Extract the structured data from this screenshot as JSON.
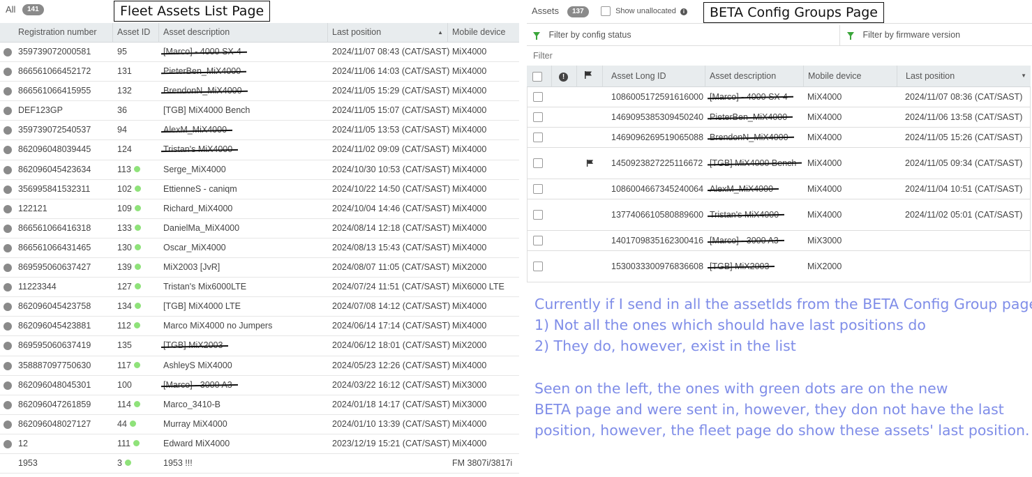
{
  "left": {
    "all_label": "All",
    "count": "141",
    "annotation": "Fleet Assets List Page",
    "headers": [
      "Registration number",
      "Asset ID",
      "Asset description",
      "Last position",
      "Mobile device"
    ],
    "rows": [
      {
        "reg": "359739072000581",
        "id": "95",
        "desc": "[Marco] - 4000 SX-4",
        "struck": true,
        "green": false,
        "pos": "2024/11/07 08:43 (CAT/SAST)",
        "device": "MiX4000",
        "grey": true
      },
      {
        "reg": "866561066452172",
        "id": "131",
        "desc": "PieterBen_MiX4000",
        "struck": true,
        "green": false,
        "pos": "2024/11/06 14:03 (CAT/SAST)",
        "device": "MiX4000",
        "grey": true
      },
      {
        "reg": "866561066415955",
        "id": "132",
        "desc": "BrendonN_MiX4000",
        "struck": true,
        "green": false,
        "pos": "2024/11/05 15:29 (CAT/SAST)",
        "device": "MiX4000",
        "grey": true
      },
      {
        "reg": "DEF123GP",
        "id": "36",
        "desc": "[TGB] MiX4000 Bench",
        "struck": false,
        "green": false,
        "pos": "2024/11/05 15:07 (CAT/SAST)",
        "device": "MiX4000",
        "grey": true
      },
      {
        "reg": "359739072540537",
        "id": "94",
        "desc": "AlexM_MiX4000",
        "struck": true,
        "green": false,
        "pos": "2024/11/05 13:53 (CAT/SAST)",
        "device": "MiX4000",
        "grey": true
      },
      {
        "reg": "862096048039445",
        "id": "124",
        "desc": "Tristan's MiX4000",
        "struck": true,
        "green": false,
        "pos": "2024/11/02 09:09 (CAT/SAST)",
        "device": "MiX4000",
        "grey": true
      },
      {
        "reg": "862096045423634",
        "id": "113",
        "desc": "Serge_MiX4000",
        "struck": false,
        "green": true,
        "pos": "2024/10/30 10:53 (CAT/SAST)",
        "device": "MiX4000",
        "grey": true
      },
      {
        "reg": "356995841532311",
        "id": "102",
        "desc": "EttienneS - caniqm",
        "struck": false,
        "green": true,
        "pos": "2024/10/22 14:50 (CAT/SAST)",
        "device": "MiX4000",
        "grey": true
      },
      {
        "reg": "122121",
        "id": "109",
        "desc": "Richard_MiX4000",
        "struck": false,
        "green": true,
        "pos": "2024/10/04 14:46 (CAT/SAST)",
        "device": "MiX4000",
        "grey": true
      },
      {
        "reg": "866561066416318",
        "id": "133",
        "desc": "DanielMa_MiX4000",
        "struck": false,
        "green": true,
        "pos": "2024/08/14 12:18 (CAT/SAST)",
        "device": "MiX4000",
        "grey": true
      },
      {
        "reg": "866561066431465",
        "id": "130",
        "desc": "Oscar_MiX4000",
        "struck": false,
        "green": true,
        "pos": "2024/08/13 15:43 (CAT/SAST)",
        "device": "MiX4000",
        "grey": true
      },
      {
        "reg": "869595060637427",
        "id": "139",
        "desc": "MiX2003 [JvR]",
        "struck": false,
        "green": true,
        "pos": "2024/08/07 11:05 (CAT/SAST)",
        "device": "MiX2000",
        "grey": true
      },
      {
        "reg": "11223344",
        "id": "127",
        "desc": "Tristan's Mix6000LTE",
        "struck": false,
        "green": true,
        "pos": "2024/07/24 11:51 (CAT/SAST)",
        "device": "MiX6000 LTE",
        "grey": true
      },
      {
        "reg": "862096045423758",
        "id": "134",
        "desc": "[TGB] MiX4000 LTE",
        "struck": false,
        "green": true,
        "pos": "2024/07/08 14:12 (CAT/SAST)",
        "device": "MiX4000",
        "grey": true
      },
      {
        "reg": "862096045423881",
        "id": "112",
        "desc": "Marco MiX4000 no Jumpers",
        "struck": false,
        "green": true,
        "pos": "2024/06/14 17:14 (CAT/SAST)",
        "device": "MiX4000",
        "grey": true
      },
      {
        "reg": "869595060637419",
        "id": "135",
        "desc": "[TGB] MiX2003",
        "struck": true,
        "green": false,
        "pos": "2024/06/12 18:01 (CAT/SAST)",
        "device": "MiX2000",
        "grey": true
      },
      {
        "reg": "358887097750630",
        "id": "117",
        "desc": "AshleyS MiX4000",
        "struck": false,
        "green": true,
        "pos": "2024/05/23 12:26 (CAT/SAST)",
        "device": "MiX4000",
        "grey": true
      },
      {
        "reg": "862096048045301",
        "id": "100",
        "desc": "[Marco] - 3000 A3",
        "struck": true,
        "green": false,
        "pos": "2024/03/22 16:12 (CAT/SAST)",
        "device": "MiX3000",
        "grey": true
      },
      {
        "reg": "862096047261859",
        "id": "114",
        "desc": "Marco_3410-B",
        "struck": false,
        "green": true,
        "pos": "2024/01/18 14:17 (CAT/SAST)",
        "device": "MiX3000",
        "grey": true
      },
      {
        "reg": "862096048027127",
        "id": "44",
        "desc": "Murray MiX4000",
        "struck": false,
        "green": true,
        "pos": "2024/01/10 13:39 (CAT/SAST)",
        "device": "MiX4000",
        "grey": true
      },
      {
        "reg": "12",
        "id": "111",
        "desc": "Edward MiX4000",
        "struck": false,
        "green": true,
        "pos": "2023/12/19 15:21 (CAT/SAST)",
        "device": "MiX4000",
        "grey": true
      },
      {
        "reg": "1953",
        "id": "3",
        "desc": "1953 !!!",
        "struck": false,
        "green": true,
        "pos": "",
        "device": "FM 3807i/3817i",
        "grey": false
      }
    ]
  },
  "right": {
    "assets_label": "Assets",
    "count": "137",
    "show_unallocated": "Show unallocated",
    "annotation": "BETA Config Groups Page",
    "filter_config": "Filter by config status",
    "filter_firmware": "Filter by firmware version",
    "filter_placeholder": "Filter",
    "headers": [
      "Asset Long ID",
      "Asset description",
      "Mobile device",
      "Last position"
    ],
    "rows": [
      {
        "long_id": "1086005172591616000",
        "desc": "[Marco] - 4000 SX-4",
        "device": "MiX4000",
        "pos": "2024/11/07 08:36 (CAT/SAST)",
        "flag": false
      },
      {
        "long_id": "1469095385309450240",
        "desc": "PieterBen_MiX4000",
        "device": "MiX4000",
        "pos": "2024/11/06 13:58 (CAT/SAST)",
        "flag": false
      },
      {
        "long_id": "1469096269519065088",
        "desc": "BrendonN_MiX4000",
        "device": "MiX4000",
        "pos": "2024/11/05 15:26 (CAT/SAST)",
        "flag": false
      },
      {
        "long_id": "1450923827225116672",
        "desc": "[TGB] MiX4000 Bench",
        "device": "MiX4000",
        "pos": "2024/11/05 09:34 (CAT/SAST)",
        "flag": true
      },
      {
        "long_id": "1086004667345240064",
        "desc": "AlexM_MiX4000",
        "device": "MiX4000",
        "pos": "2024/11/04 10:51 (CAT/SAST)",
        "flag": false
      },
      {
        "long_id": "1377406610580889600",
        "desc": "Tristan's MiX4000",
        "device": "MiX4000",
        "pos": "2024/11/02 05:01 (CAT/SAST)",
        "flag": false
      },
      {
        "long_id": "1401709835162300416",
        "desc": "[Marco] - 3000 A3",
        "device": "MiX3000",
        "pos": "",
        "flag": false
      },
      {
        "long_id": "1530033300976836608",
        "desc": "[TGB] MiX2003",
        "device": "MiX2000",
        "pos": "",
        "flag": false
      }
    ]
  },
  "note": {
    "line1": "Currently if I send in all the assetIds from the BETA Config Group page:",
    "line2": "1) Not all the ones which should have last positions do",
    "line3": "2) They do, however, exist in the list",
    "line4": "Seen on the left, the ones with green dots are on the new",
    "line5": "BETA page and were sent in, however, they don not have the last",
    "line6": "position, however, the fleet page do show these assets' last position."
  },
  "colors": {
    "green_desc": "#4cae4c",
    "green_dot": "#8fe27a",
    "note_text": "#7f8de8",
    "header_bg": "#e8ecee"
  },
  "icons": [
    "filter-icon",
    "info-icon",
    "exclamation-icon",
    "flag-icon",
    "sort-ascending-icon",
    "sort-descending-icon"
  ]
}
